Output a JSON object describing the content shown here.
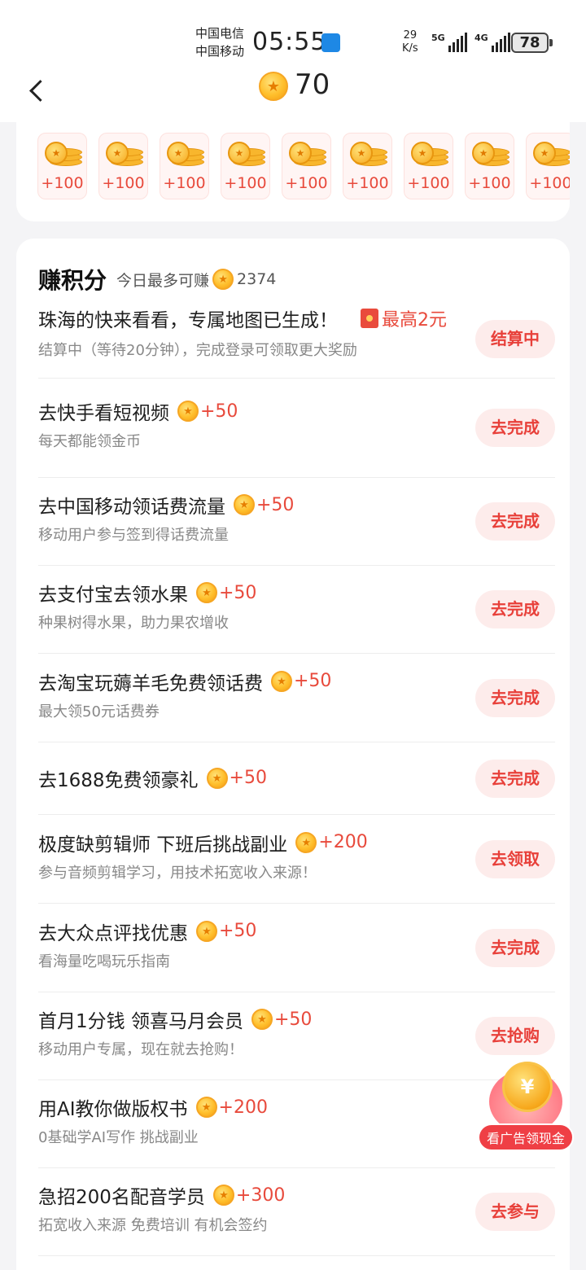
{
  "status_bar": {
    "carrier1": "中国电信",
    "carrier2": "中国移动",
    "time": "05:55",
    "speed_value": "29",
    "speed_unit": "K/s",
    "net1": "5G",
    "net2": "4G",
    "battery": "78"
  },
  "header": {
    "back_icon": "back-arrow-icon",
    "coin_total": "70"
  },
  "reward_strip": [
    "+100",
    "+100",
    "+100",
    "+100",
    "+100",
    "+100",
    "+100",
    "+100",
    "+100"
  ],
  "earn": {
    "title": "赚积分",
    "subtitle": "今日最多可赚",
    "max_points": "2374"
  },
  "tasks": [
    {
      "title": "珠海的快来看看，专属地图已生成！",
      "bonus": "最高2元",
      "desc": "结算中（等待20分钟），完成登录可领取更大奖励",
      "button": "结算中"
    },
    {
      "title": "去快手看短视频",
      "reward": "+50",
      "desc": "每天都能领金币",
      "button": "去完成"
    },
    {
      "title": "去中国移动领话费流量",
      "reward": "+50",
      "desc": "移动用户参与签到得话费流量",
      "button": "去完成"
    },
    {
      "title": "去支付宝去领水果",
      "reward": "+50",
      "desc": "种果树得水果，助力果农增收",
      "button": "去完成"
    },
    {
      "title": "去淘宝玩薅羊毛免费领话费",
      "reward": "+50",
      "desc": "最大领50元话费券",
      "button": "去完成"
    },
    {
      "title": "去1688免费领豪礼",
      "reward": "+50",
      "desc": "",
      "button": "去完成"
    },
    {
      "title": "极度缺剪辑师 下班后挑战副业",
      "reward": "+200",
      "desc": "参与音频剪辑学习，用技术拓宽收入来源！",
      "button": "去领取"
    },
    {
      "title": "去大众点评找优惠",
      "reward": "+50",
      "desc": "看海量吃喝玩乐指南",
      "button": "去完成"
    },
    {
      "title": "首月1分钱 领喜马月会员",
      "reward": "+50",
      "desc": "移动用户专属，现在就去抢购！",
      "button": "去抢购"
    },
    {
      "title": "用AI教你做版权书",
      "reward": "+200",
      "desc": "0基础学AI写作 挑战副业",
      "button": ""
    },
    {
      "title": "急招200名配音学员",
      "reward": "+300",
      "desc": "拓宽收入来源 免费培训 有机会签约",
      "button": "去参与"
    }
  ],
  "float_ad": {
    "label": "看广告领现金",
    "coin_symbol": "¥"
  }
}
